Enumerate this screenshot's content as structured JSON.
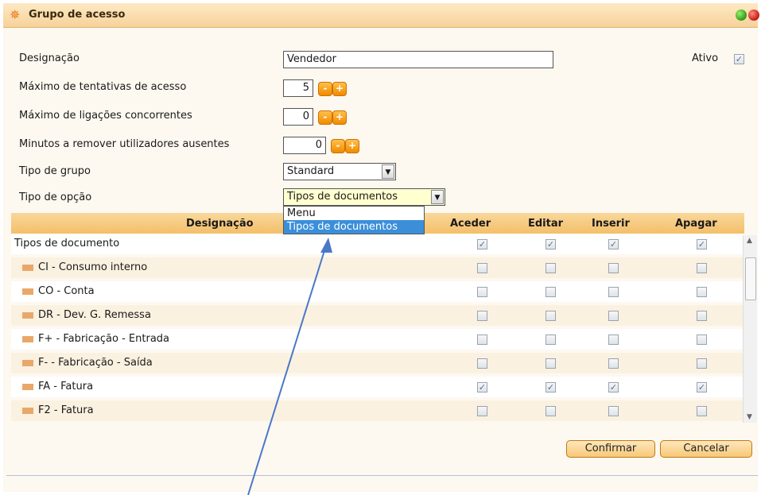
{
  "window": {
    "title": "Grupo de acesso"
  },
  "form": {
    "designacao_label": "Designação",
    "designacao_value": "Vendedor",
    "ativo_label": "Ativo",
    "max_tentativas_label": "Máximo de tentativas de acesso",
    "max_tentativas_value": "5",
    "max_ligacoes_label": "Máximo de ligações concorrentes",
    "max_ligacoes_value": "0",
    "minutos_label": "Minutos a remover utilizadores ausentes",
    "minutos_value": "0",
    "tipo_grupo_label": "Tipo de grupo",
    "tipo_grupo_value": "Standard",
    "tipo_opcao_label": "Tipo de opção",
    "tipo_opcao_value": "Tipos de documentos",
    "minus": "-",
    "plus": "+"
  },
  "dropdown": {
    "options": [
      "Menu",
      "Tipos de documentos"
    ]
  },
  "table": {
    "headers": [
      "Designação",
      "Aceder",
      "Editar",
      "Inserir",
      "Apagar"
    ],
    "rows": [
      {
        "label": "Tipos de documento",
        "checks": [
          true,
          true,
          true,
          true
        ]
      },
      {
        "label": "CI - Consumo interno",
        "checks": [
          false,
          false,
          false,
          false
        ]
      },
      {
        "label": "CO - Conta",
        "checks": [
          false,
          false,
          false,
          false
        ]
      },
      {
        "label": "DR - Dev. G. Remessa",
        "checks": [
          false,
          false,
          false,
          false
        ]
      },
      {
        "label": "F+ - Fabricação - Entrada",
        "checks": [
          false,
          false,
          false,
          false
        ]
      },
      {
        "label": "F- - Fabricação - Saída",
        "checks": [
          false,
          false,
          false,
          false
        ]
      },
      {
        "label": "FA - Fatura",
        "checks": [
          true,
          true,
          true,
          true
        ]
      },
      {
        "label": "F2 - Fatura",
        "checks": [
          false,
          false,
          false,
          false
        ]
      }
    ]
  },
  "buttons": {
    "confirm": "Confirmar",
    "cancel": "Cancelar"
  },
  "colors": {
    "header_bg": "#f3bf6a",
    "accent_orange": "#f08a00",
    "selection_blue": "#3b8fd9",
    "annotation_arrow": "#4a78c8"
  }
}
